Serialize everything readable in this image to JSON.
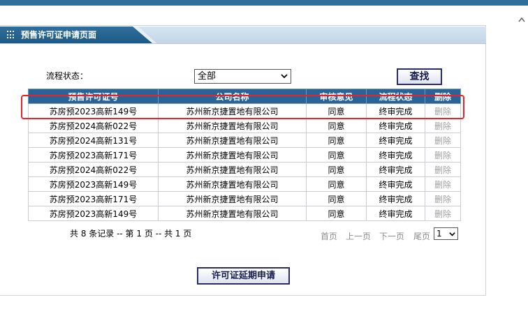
{
  "page": {
    "title": "预售许可证申请页面"
  },
  "filter": {
    "status_label": "流程状态：",
    "status_value": "全部",
    "search_label": "查找"
  },
  "table": {
    "columns": [
      "预售许可证号",
      "公司名称",
      "审核意见",
      "流程状态",
      "删除"
    ],
    "rows": [
      [
        "苏房预2023高新149号",
        "苏州新京捷置地有限公司",
        "同意",
        "终审完成",
        "删除"
      ],
      [
        "苏房预2024高新022号",
        "苏州新京捷置地有限公司",
        "同意",
        "终审完成",
        "删除"
      ],
      [
        "苏房预2024高新131号",
        "苏州新京捷置地有限公司",
        "同意",
        "终审完成",
        "删除"
      ],
      [
        "苏房预2023高新171号",
        "苏州新京捷置地有限公司",
        "同意",
        "终审完成",
        "删除"
      ],
      [
        "苏房预2024高新022号",
        "苏州新京捷置地有限公司",
        "同意",
        "终审完成",
        "删除"
      ],
      [
        "苏房预2023高新149号",
        "苏州新京捷置地有限公司",
        "同意",
        "终审完成",
        "删除"
      ],
      [
        "苏房预2023高新171号",
        "苏州新京捷置地有限公司",
        "同意",
        "终审完成",
        "删除"
      ],
      [
        "苏房预2023高新149号",
        "苏州新京捷置地有限公司",
        "同意",
        "终审完成",
        "删除"
      ]
    ]
  },
  "pager": {
    "summary": "共 8 条记录 -- 第 1 页 -- 共 1 页",
    "first": "首页",
    "prev": "上一页",
    "next": "下一页",
    "last": "尾页",
    "page_value": "1"
  },
  "actions": {
    "extend_label": "许可证延期申请"
  },
  "colors": {
    "header_bg": "#2a6497",
    "highlight": "#e8212b",
    "top_bar": "#2f6f9b"
  }
}
